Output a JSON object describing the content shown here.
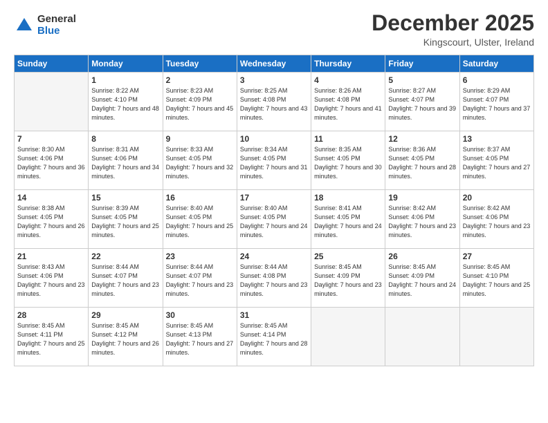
{
  "logo": {
    "general": "General",
    "blue": "Blue"
  },
  "title": "December 2025",
  "location": "Kingscourt, Ulster, Ireland",
  "weekdays": [
    "Sunday",
    "Monday",
    "Tuesday",
    "Wednesday",
    "Thursday",
    "Friday",
    "Saturday"
  ],
  "weeks": [
    [
      {
        "day": "",
        "sunrise": "",
        "sunset": "",
        "daylight": ""
      },
      {
        "day": "1",
        "sunrise": "Sunrise: 8:22 AM",
        "sunset": "Sunset: 4:10 PM",
        "daylight": "Daylight: 7 hours and 48 minutes."
      },
      {
        "day": "2",
        "sunrise": "Sunrise: 8:23 AM",
        "sunset": "Sunset: 4:09 PM",
        "daylight": "Daylight: 7 hours and 45 minutes."
      },
      {
        "day": "3",
        "sunrise": "Sunrise: 8:25 AM",
        "sunset": "Sunset: 4:08 PM",
        "daylight": "Daylight: 7 hours and 43 minutes."
      },
      {
        "day": "4",
        "sunrise": "Sunrise: 8:26 AM",
        "sunset": "Sunset: 4:08 PM",
        "daylight": "Daylight: 7 hours and 41 minutes."
      },
      {
        "day": "5",
        "sunrise": "Sunrise: 8:27 AM",
        "sunset": "Sunset: 4:07 PM",
        "daylight": "Daylight: 7 hours and 39 minutes."
      },
      {
        "day": "6",
        "sunrise": "Sunrise: 8:29 AM",
        "sunset": "Sunset: 4:07 PM",
        "daylight": "Daylight: 7 hours and 37 minutes."
      }
    ],
    [
      {
        "day": "7",
        "sunrise": "Sunrise: 8:30 AM",
        "sunset": "Sunset: 4:06 PM",
        "daylight": "Daylight: 7 hours and 36 minutes."
      },
      {
        "day": "8",
        "sunrise": "Sunrise: 8:31 AM",
        "sunset": "Sunset: 4:06 PM",
        "daylight": "Daylight: 7 hours and 34 minutes."
      },
      {
        "day": "9",
        "sunrise": "Sunrise: 8:33 AM",
        "sunset": "Sunset: 4:05 PM",
        "daylight": "Daylight: 7 hours and 32 minutes."
      },
      {
        "day": "10",
        "sunrise": "Sunrise: 8:34 AM",
        "sunset": "Sunset: 4:05 PM",
        "daylight": "Daylight: 7 hours and 31 minutes."
      },
      {
        "day": "11",
        "sunrise": "Sunrise: 8:35 AM",
        "sunset": "Sunset: 4:05 PM",
        "daylight": "Daylight: 7 hours and 30 minutes."
      },
      {
        "day": "12",
        "sunrise": "Sunrise: 8:36 AM",
        "sunset": "Sunset: 4:05 PM",
        "daylight": "Daylight: 7 hours and 28 minutes."
      },
      {
        "day": "13",
        "sunrise": "Sunrise: 8:37 AM",
        "sunset": "Sunset: 4:05 PM",
        "daylight": "Daylight: 7 hours and 27 minutes."
      }
    ],
    [
      {
        "day": "14",
        "sunrise": "Sunrise: 8:38 AM",
        "sunset": "Sunset: 4:05 PM",
        "daylight": "Daylight: 7 hours and 26 minutes."
      },
      {
        "day": "15",
        "sunrise": "Sunrise: 8:39 AM",
        "sunset": "Sunset: 4:05 PM",
        "daylight": "Daylight: 7 hours and 25 minutes."
      },
      {
        "day": "16",
        "sunrise": "Sunrise: 8:40 AM",
        "sunset": "Sunset: 4:05 PM",
        "daylight": "Daylight: 7 hours and 25 minutes."
      },
      {
        "day": "17",
        "sunrise": "Sunrise: 8:40 AM",
        "sunset": "Sunset: 4:05 PM",
        "daylight": "Daylight: 7 hours and 24 minutes."
      },
      {
        "day": "18",
        "sunrise": "Sunrise: 8:41 AM",
        "sunset": "Sunset: 4:05 PM",
        "daylight": "Daylight: 7 hours and 24 minutes."
      },
      {
        "day": "19",
        "sunrise": "Sunrise: 8:42 AM",
        "sunset": "Sunset: 4:06 PM",
        "daylight": "Daylight: 7 hours and 23 minutes."
      },
      {
        "day": "20",
        "sunrise": "Sunrise: 8:42 AM",
        "sunset": "Sunset: 4:06 PM",
        "daylight": "Daylight: 7 hours and 23 minutes."
      }
    ],
    [
      {
        "day": "21",
        "sunrise": "Sunrise: 8:43 AM",
        "sunset": "Sunset: 4:06 PM",
        "daylight": "Daylight: 7 hours and 23 minutes."
      },
      {
        "day": "22",
        "sunrise": "Sunrise: 8:44 AM",
        "sunset": "Sunset: 4:07 PM",
        "daylight": "Daylight: 7 hours and 23 minutes."
      },
      {
        "day": "23",
        "sunrise": "Sunrise: 8:44 AM",
        "sunset": "Sunset: 4:07 PM",
        "daylight": "Daylight: 7 hours and 23 minutes."
      },
      {
        "day": "24",
        "sunrise": "Sunrise: 8:44 AM",
        "sunset": "Sunset: 4:08 PM",
        "daylight": "Daylight: 7 hours and 23 minutes."
      },
      {
        "day": "25",
        "sunrise": "Sunrise: 8:45 AM",
        "sunset": "Sunset: 4:09 PM",
        "daylight": "Daylight: 7 hours and 23 minutes."
      },
      {
        "day": "26",
        "sunrise": "Sunrise: 8:45 AM",
        "sunset": "Sunset: 4:09 PM",
        "daylight": "Daylight: 7 hours and 24 minutes."
      },
      {
        "day": "27",
        "sunrise": "Sunrise: 8:45 AM",
        "sunset": "Sunset: 4:10 PM",
        "daylight": "Daylight: 7 hours and 25 minutes."
      }
    ],
    [
      {
        "day": "28",
        "sunrise": "Sunrise: 8:45 AM",
        "sunset": "Sunset: 4:11 PM",
        "daylight": "Daylight: 7 hours and 25 minutes."
      },
      {
        "day": "29",
        "sunrise": "Sunrise: 8:45 AM",
        "sunset": "Sunset: 4:12 PM",
        "daylight": "Daylight: 7 hours and 26 minutes."
      },
      {
        "day": "30",
        "sunrise": "Sunrise: 8:45 AM",
        "sunset": "Sunset: 4:13 PM",
        "daylight": "Daylight: 7 hours and 27 minutes."
      },
      {
        "day": "31",
        "sunrise": "Sunrise: 8:45 AM",
        "sunset": "Sunset: 4:14 PM",
        "daylight": "Daylight: 7 hours and 28 minutes."
      },
      {
        "day": "",
        "sunrise": "",
        "sunset": "",
        "daylight": ""
      },
      {
        "day": "",
        "sunrise": "",
        "sunset": "",
        "daylight": ""
      },
      {
        "day": "",
        "sunrise": "",
        "sunset": "",
        "daylight": ""
      }
    ]
  ]
}
